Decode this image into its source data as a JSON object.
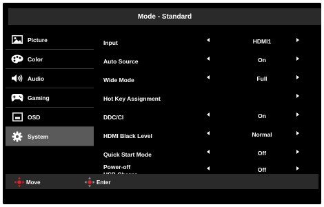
{
  "title": "Mode - Standard",
  "sidebar": {
    "items": [
      {
        "label": "Picture",
        "icon": "picture-icon"
      },
      {
        "label": "Color",
        "icon": "palette-icon"
      },
      {
        "label": "Audio",
        "icon": "speaker-icon"
      },
      {
        "label": "Gaming",
        "icon": "gamepad-icon"
      },
      {
        "label": "OSD",
        "icon": "osd-icon"
      },
      {
        "label": "System",
        "icon": "gear-icon",
        "selected": true
      }
    ]
  },
  "settings": [
    {
      "label": "Input",
      "value": "HDMI1"
    },
    {
      "label": "Auto Source",
      "value": "On"
    },
    {
      "label": "Wide Mode",
      "value": "Full"
    },
    {
      "label": "Hot Key Assignment",
      "value": ""
    },
    {
      "label": "DDC/CI",
      "value": "On"
    },
    {
      "label": "HDMI Black Level",
      "value": "Normal"
    },
    {
      "label": "Quick Start Mode",
      "value": "Off"
    },
    {
      "label": "Power-off USB Charge",
      "label_line1": "Power-off",
      "label_line2": "USB Charge",
      "value": "Off"
    }
  ],
  "footer": {
    "move_label": "Move",
    "enter_label": "Enter"
  },
  "colors": {
    "background": "#000000",
    "bar": "#2a2a2a",
    "selected": "#5a5a5a",
    "accent": "#e0202c",
    "text": "#ffffff"
  }
}
